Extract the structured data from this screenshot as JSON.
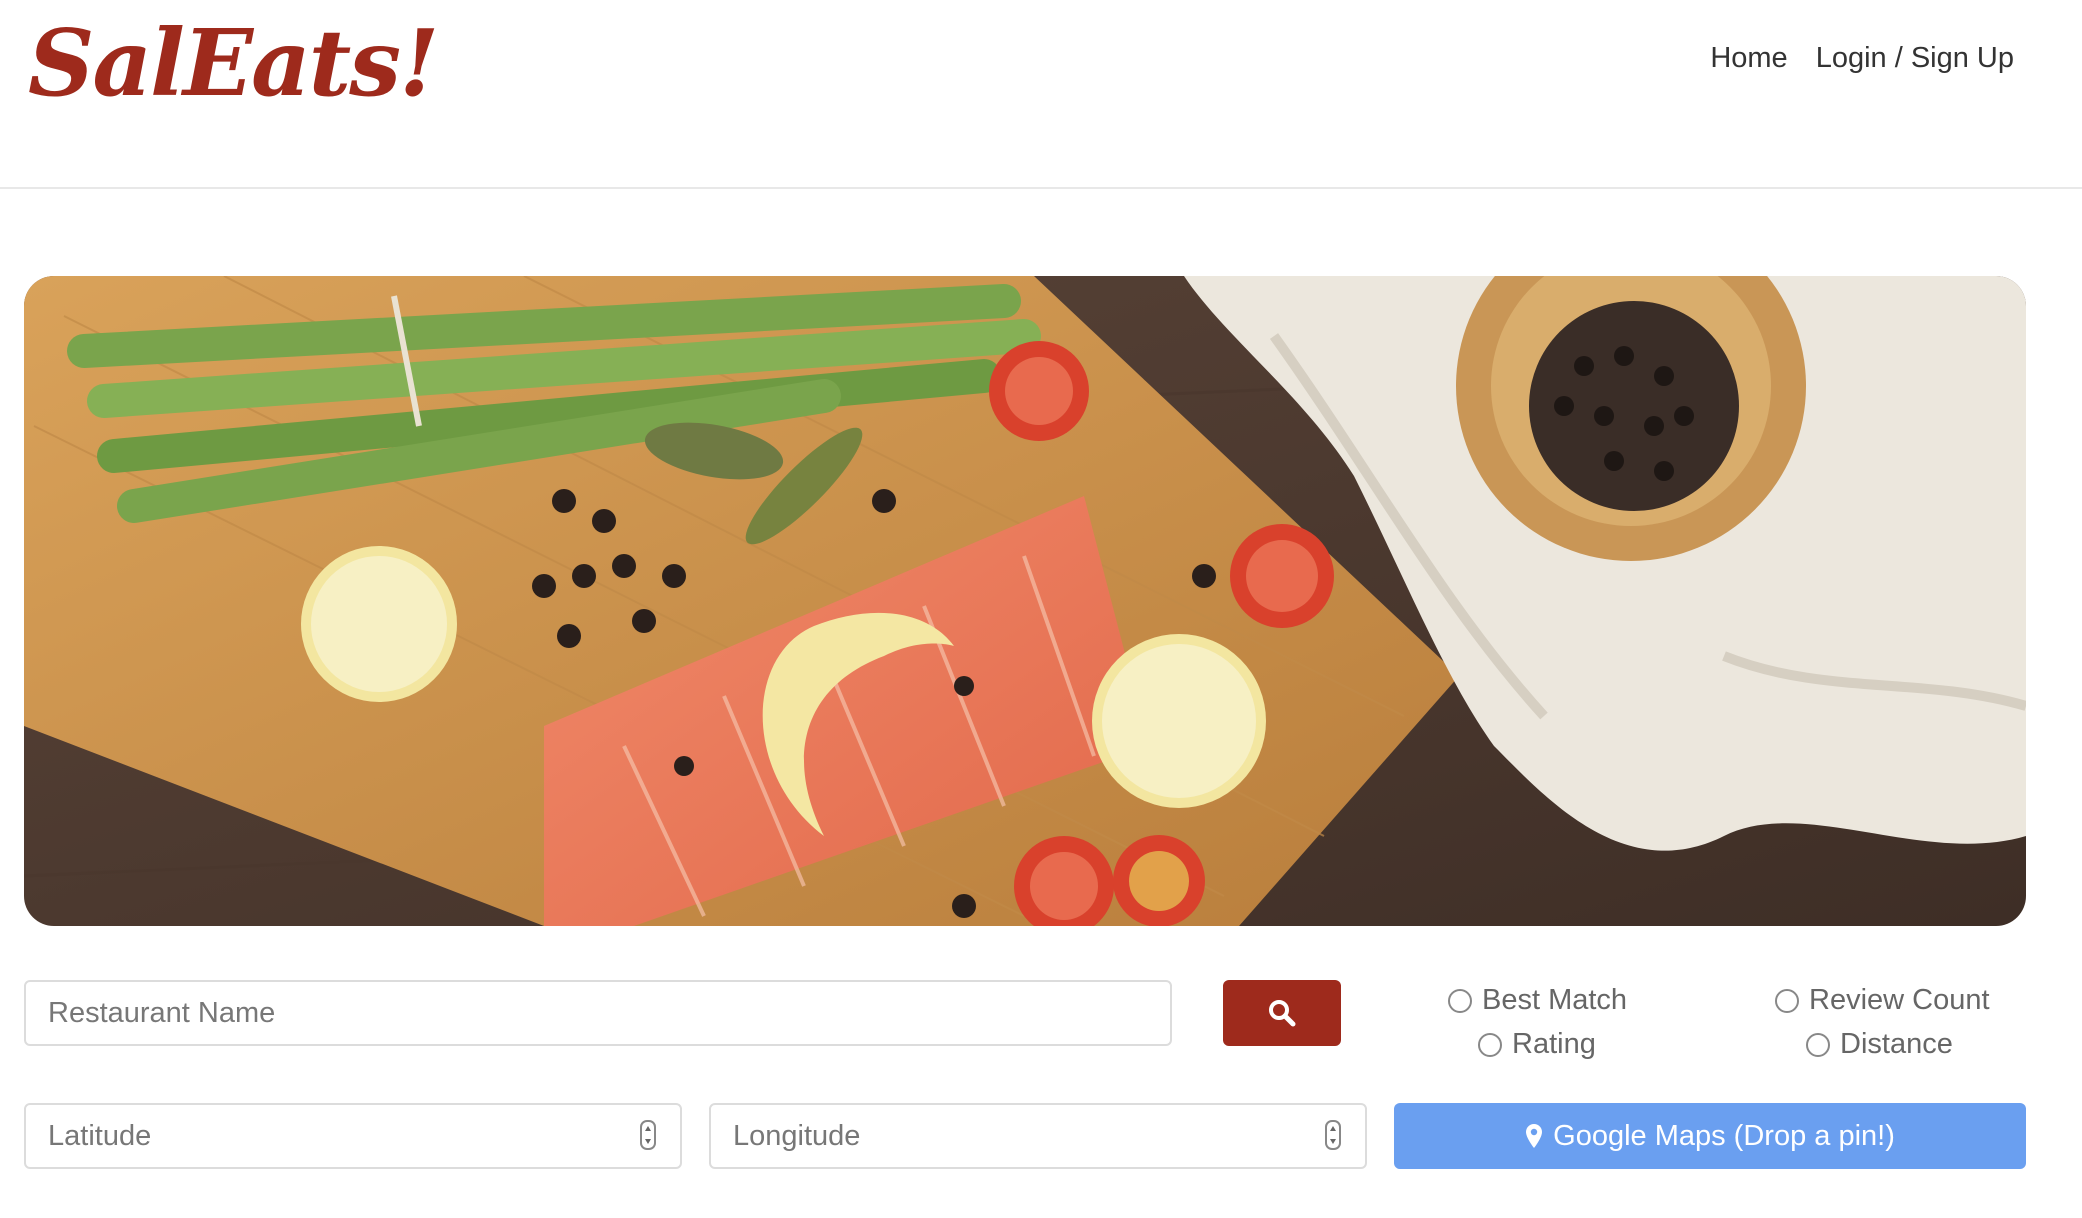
{
  "header": {
    "logo": "SalEats!",
    "nav": {
      "home": "Home",
      "login": "Login / Sign Up"
    }
  },
  "hero": {
    "image_alt": "salmon fillet with lemon, tomatoes, asparagus and peppercorns"
  },
  "search": {
    "name_placeholder": "Restaurant Name",
    "latitude_placeholder": "Latitude",
    "longitude_placeholder": "Longitude",
    "search_icon": "search-icon",
    "sort_options": [
      "Best Match",
      "Review Count",
      "Rating",
      "Distance"
    ],
    "maps_button": "Google Maps (Drop a pin!)",
    "maps_icon": "map-pin-icon"
  },
  "colors": {
    "brand": "#9e2a1c",
    "maps_button": "#6a9ff0"
  }
}
